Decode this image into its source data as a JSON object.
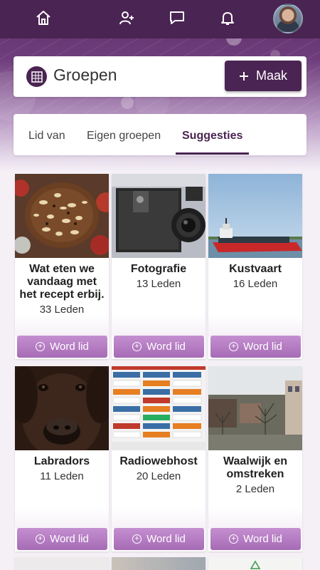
{
  "nav": {
    "icons": [
      "home-icon",
      "add-user-icon",
      "chat-icon",
      "bell-icon"
    ],
    "avatar": "user-avatar"
  },
  "header": {
    "title": "Groepen",
    "make_label": "Maak",
    "make_icon": "plus-icon"
  },
  "tabs": [
    {
      "label": "Lid van",
      "active": false
    },
    {
      "label": "Eigen groepen",
      "active": false
    },
    {
      "label": "Suggesties",
      "active": true
    }
  ],
  "groups": [
    {
      "name": "Wat eten we vandaag met het recept erbij.",
      "members": "33 Leden",
      "join": "Word lid"
    },
    {
      "name": "Fotografie",
      "members": "13 Leden",
      "join": "Word lid"
    },
    {
      "name": "Kustvaart",
      "members": "16 Leden",
      "join": "Word lid"
    },
    {
      "name": "Labradors",
      "members": "11 Leden",
      "join": "Word lid"
    },
    {
      "name": "Radiowebhost",
      "members": "20 Leden",
      "join": "Word lid"
    },
    {
      "name": "Waalwijk en omstreken",
      "members": "2 Leden",
      "join": "Word lid"
    }
  ],
  "colors": {
    "primary": "#4a2452",
    "join_button": "#b57cc3"
  }
}
